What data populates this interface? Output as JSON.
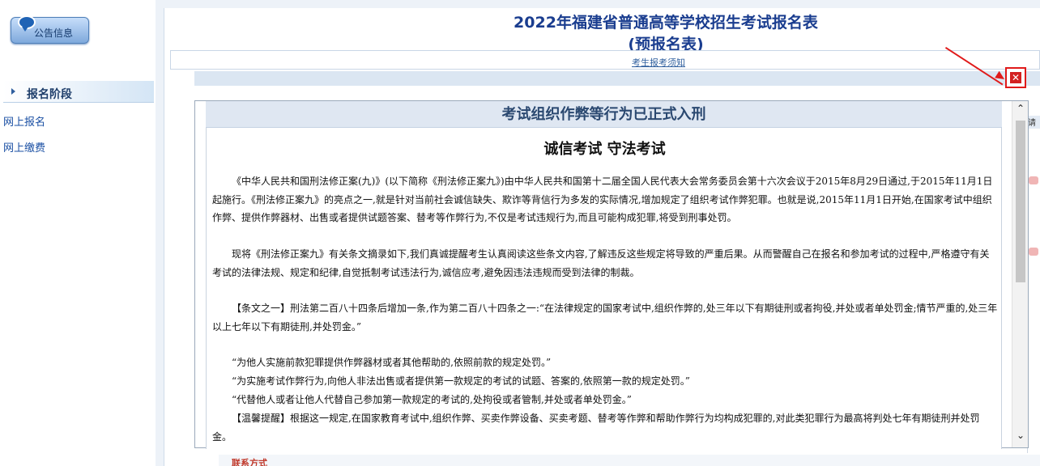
{
  "sidebar": {
    "notice_button": "公告信息",
    "stage_label": "报名阶段",
    "links": [
      "网上报名",
      "网上缴费"
    ]
  },
  "page": {
    "title_line1": "2022年福建省普通高等学校招生考试报名表",
    "title_line2": "(预报名表)",
    "notice_link": "考生报考须知",
    "behind_header": "请",
    "bottom_peek": "联系方式"
  },
  "modal": {
    "header": "考试组织作弊等行为已正式入刑",
    "subtitle": "诚信考试 守法考试",
    "paragraphs": [
      "《中华人民共和国刑法修正案(九)》(以下简称《刑法修正案九》)由中华人民共和国第十二届全国人民代表大会常务委员会第十六次会议于2015年8月29日通过,于2015年11月1日起施行。《刑法修正案九》的亮点之一,就是针对当前社会诚信缺失、欺诈等背信行为多发的实际情况,增加规定了组织考试作弊犯罪。也就是说,2015年11月1日开始,在国家考试中组织作弊、提供作弊器材、出售或者提供试题答案、替考等作弊行为,不仅是考试违规行为,而且可能构成犯罪,将受到刑事处罚。",
      "现将《刑法修正案九》有关条文摘录如下,我们真诚提醒考生认真阅读这些条文内容,了解违反这些规定将导致的严重后果。从而警醒自己在报名和参加考试的过程中,严格遵守有关考试的法律法规、规定和纪律,自觉抵制考试违法行为,诚信应考,避免因违法违规而受到法律的制裁。",
      "【条文之一】刑法第二百八十四条后增加一条,作为第二百八十四条之一:“在法律规定的国家考试中,组织作弊的,处三年以下有期徒刑或者拘役,并处或者单处罚金;情节严重的,处三年以上七年以下有期徒刑,并处罚金。”",
      "“为他人实施前款犯罪提供作弊器材或者其他帮助的,依照前款的规定处罚。”",
      "“为实施考试作弊行为,向他人非法出售或者提供第一款规定的考试的试题、答案的,依照第一款的规定处罚。”",
      "“代替他人或者让他人代替自己参加第一款规定的考试的,处拘役或者管制,并处或者单处罚金。”",
      "【温馨提醒】根据这一规定,在国家教育考试中,组织作弊、买卖作弊设备、买卖考题、替考等作弊和帮助作弊行为均构成犯罪的,对此类犯罪行为最高将判处七年有期徒刑并处罚金。"
    ],
    "scroll_up": "⌃",
    "scroll_down": "⌄",
    "close_label": "✕"
  },
  "icons": [
    "speech-bubble-icon",
    "arrow-right-icon",
    "close-icon",
    "chevron-up-icon",
    "chevron-down-icon"
  ],
  "colors": {
    "title": "#1a3d8f",
    "link": "#1a4fa3",
    "close_red": "#e01a1a",
    "header_bar": "#dfe7f2"
  }
}
